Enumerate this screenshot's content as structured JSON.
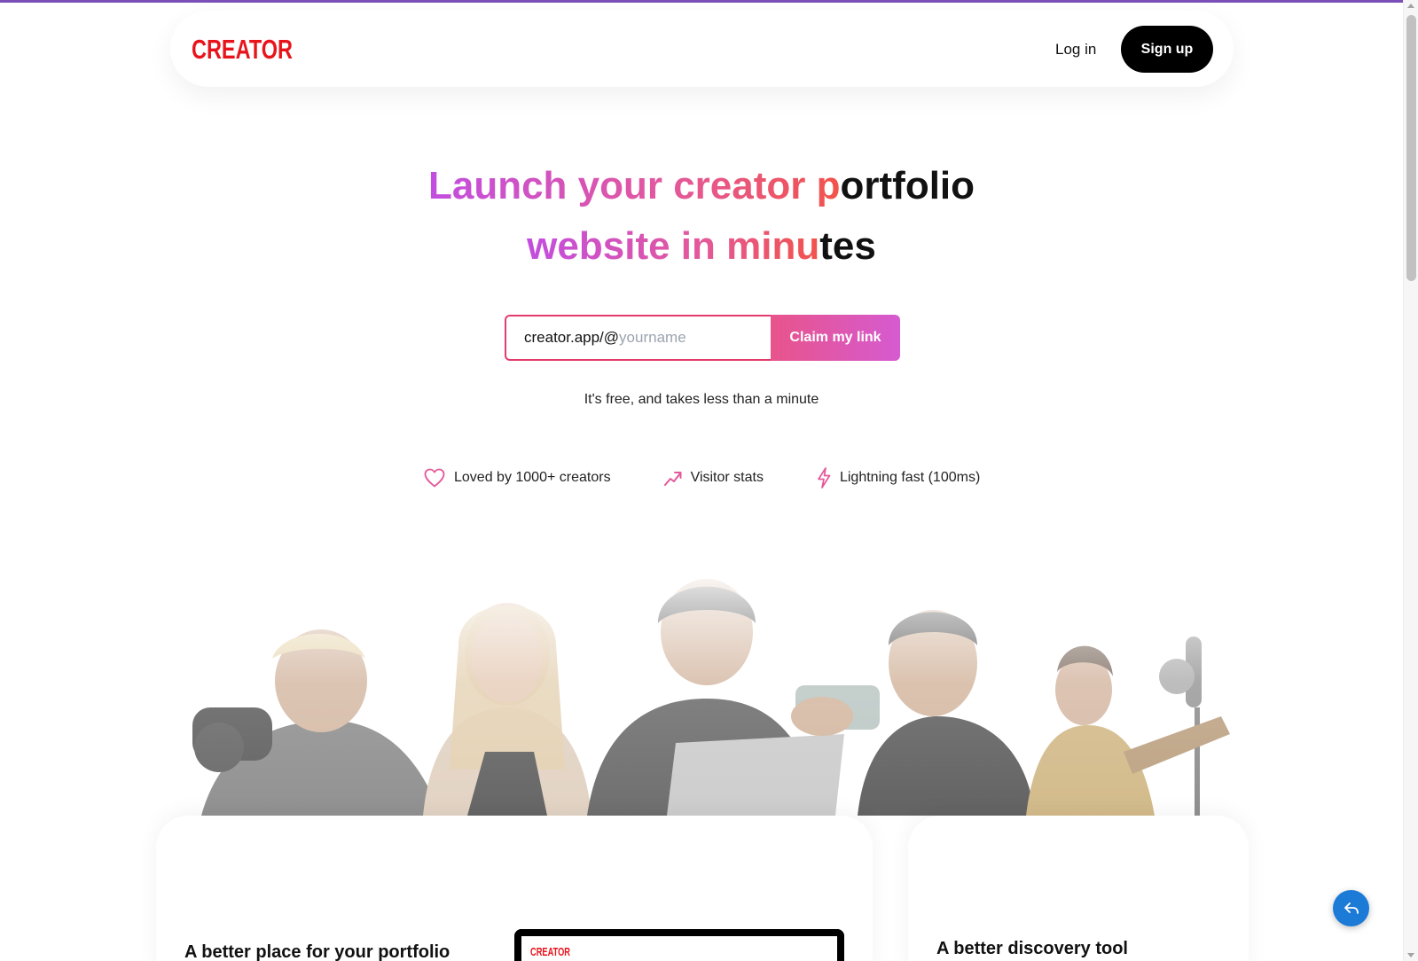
{
  "brand": {
    "logo_text": "CREATOR",
    "color": "#e8141c"
  },
  "nav": {
    "login_label": "Log in",
    "signup_label": "Sign up"
  },
  "hero": {
    "title_line1_gradient": "Launch your creator p",
    "title_line1_dark": "ortfolio",
    "title_line2_gradient": "website in minu",
    "title_line2_dark": "tes",
    "gradient_colors": [
      "#c24ee0",
      "#e4589a",
      "#f2534a"
    ]
  },
  "claim": {
    "prefix": "creator.app/@",
    "placeholder": "yourname",
    "button_label": "Claim my link",
    "note": "It's free, and takes less than a minute"
  },
  "features": [
    {
      "icon": "heart-icon",
      "label": "Loved by 1000+ creators"
    },
    {
      "icon": "trending-up-icon",
      "label": "Visitor stats"
    },
    {
      "icon": "lightning-icon",
      "label": "Lightning fast (100ms)"
    }
  ],
  "cards": {
    "left_title": "A better place for your portfolio",
    "right_title": "A better discovery tool"
  },
  "fab": {
    "icon": "reply-icon",
    "color": "#1c7bd6"
  }
}
